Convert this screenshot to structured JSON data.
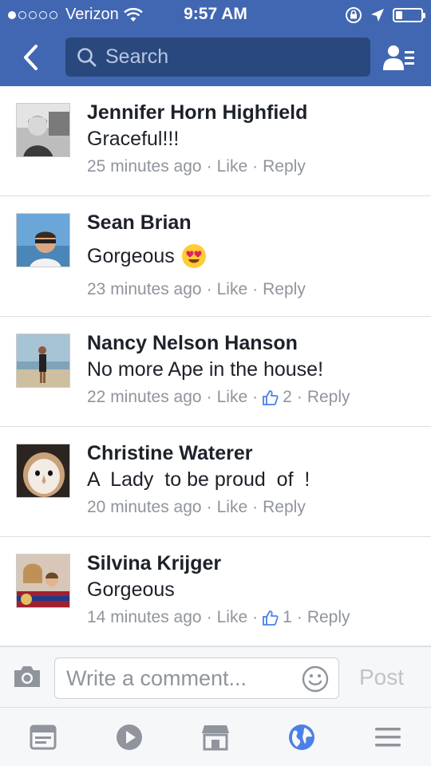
{
  "status_bar": {
    "carrier": "Verizon",
    "time": "9:57 AM",
    "signal_bars": 1,
    "battery_level": 0.25
  },
  "nav": {
    "search_placeholder": "Search",
    "back_icon": "back-chevron-icon",
    "friends_icon": "friend-list-icon"
  },
  "colors": {
    "brand": "#4267b2",
    "search_bg": "#29487d",
    "meta_text": "#90949c",
    "active_tab": "#4a80e8"
  },
  "comments": [
    {
      "name": "Jennifer Horn Highfield",
      "text": "Graceful!!!",
      "time": "25 minutes ago",
      "like_label": "Like",
      "reply_label": "Reply"
    },
    {
      "name": "Sean Brian",
      "text": "Gorgeous",
      "emoji": "heart-eyes-emoji",
      "time": "23 minutes ago",
      "like_label": "Like",
      "reply_label": "Reply"
    },
    {
      "name": "Nancy Nelson Hanson",
      "text": "No more Ape in the house!",
      "time": "22 minutes ago",
      "like_label": "Like",
      "like_count": "2",
      "reply_label": "Reply"
    },
    {
      "name": "Christine Waterer",
      "text": "A  Lady  to be proud  of  !",
      "time": "20 minutes ago",
      "like_label": "Like",
      "reply_label": "Reply"
    },
    {
      "name": "Silvina Krijger",
      "text": "Gorgeous",
      "time": "14 minutes ago",
      "like_label": "Like",
      "like_count": "1",
      "reply_label": "Reply"
    }
  ],
  "composer": {
    "placeholder": "Write a comment...",
    "post_label": "Post",
    "camera_icon": "camera-icon",
    "emoji_icon": "smiley-icon"
  },
  "tabbar": {
    "tabs": [
      {
        "icon": "news-feed-icon",
        "active": false
      },
      {
        "icon": "video-play-icon",
        "active": false
      },
      {
        "icon": "marketplace-icon",
        "active": false
      },
      {
        "icon": "globe-notifications-icon",
        "active": true
      },
      {
        "icon": "menu-icon",
        "active": false
      }
    ]
  }
}
